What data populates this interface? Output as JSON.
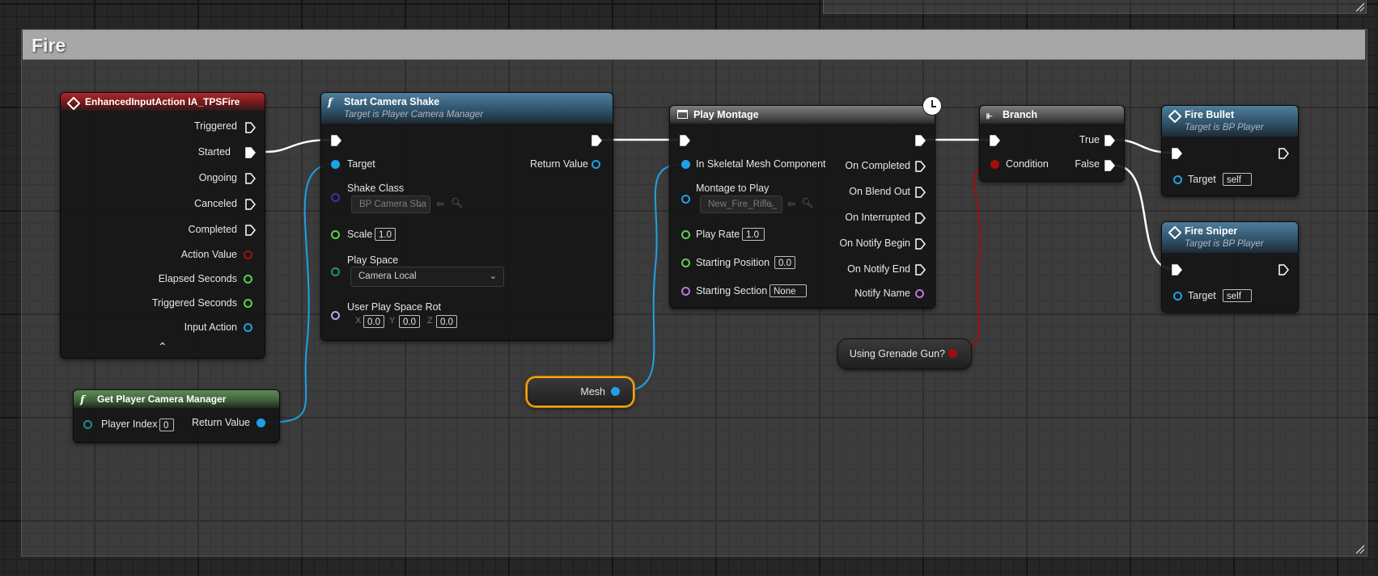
{
  "comment": {
    "title": "Fire"
  },
  "colors": {
    "exec": "#ffffff",
    "object": "#1fa0e6",
    "float": "#5bd14a",
    "struct": "#1a8f8f",
    "byte": "#4b2fa0",
    "rotator": "#a9a9e8",
    "name": "#b57adb",
    "bool": "#a00e0e",
    "selection": "#f1a512"
  },
  "input_action": {
    "title": "EnhancedInputAction IA_TPSFire",
    "icon": "diamond-event-icon",
    "outputs": [
      "Triggered",
      "Started",
      "Ongoing",
      "Canceled",
      "Completed"
    ],
    "values": [
      "Action Value",
      "Elapsed Seconds",
      "Triggered Seconds",
      "Input Action"
    ],
    "collapse_icon": "chevron-up-icon"
  },
  "get_camera_manager": {
    "title": "Get Player Camera Manager",
    "player_index_label": "Player Index",
    "player_index_value": "0",
    "return_label": "Return Value"
  },
  "camera_shake": {
    "title": "Start Camera Shake",
    "subtitle": "Target is Player Camera Manager",
    "target_label": "Target",
    "return_label": "Return Value",
    "shake_class_label": "Shake Class",
    "shake_class_value": "BP Camera Sha",
    "scale_label": "Scale",
    "scale_value": "1.0",
    "play_space_label": "Play Space",
    "play_space_value": "Camera Local",
    "rot_label": "User Play Space Rot",
    "rot_x_label": "X",
    "rot_x": "0.0",
    "rot_y_label": "Y",
    "rot_y": "0.0",
    "rot_z_label": "Z",
    "rot_z": "0.0"
  },
  "mesh_var": {
    "label": "Mesh"
  },
  "play_montage": {
    "title": "Play Montage",
    "mesh_label": "In Skeletal Mesh Component",
    "montage_label": "Montage to Play",
    "montage_value": "New_Fire_Rifle_",
    "rate_label": "Play Rate",
    "rate_value": "1.0",
    "start_pos_label": "Starting Position",
    "start_pos_value": "0.0",
    "start_section_label": "Starting Section",
    "start_section_value": "None",
    "outputs": [
      "On Completed",
      "On Blend Out",
      "On Interrupted",
      "On Notify Begin",
      "On Notify End"
    ],
    "notify_name_label": "Notify Name"
  },
  "grenade_var": {
    "label": "Using Grenade Gun?"
  },
  "branch": {
    "title": "Branch",
    "condition_label": "Condition",
    "true_label": "True",
    "false_label": "False"
  },
  "fire_bullet": {
    "title": "Fire Bullet",
    "subtitle": "Target is BP Player",
    "target_label": "Target",
    "target_value": "self"
  },
  "fire_sniper": {
    "title": "Fire Sniper",
    "subtitle": "Target is BP Player",
    "target_label": "Target",
    "target_value": "self"
  }
}
